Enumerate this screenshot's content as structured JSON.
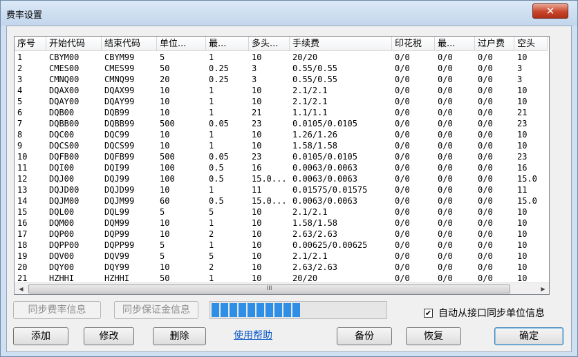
{
  "window": {
    "title": "费率设置",
    "close_glyph": "✕"
  },
  "table": {
    "columns": [
      "序号",
      "开始代码",
      "结束代码",
      "单位...",
      "最...",
      "多头...",
      "手续费",
      "印花税",
      "最...",
      "过户费",
      "空头"
    ],
    "rows": [
      [
        "1",
        "CBYM00",
        "CBYM99",
        "5",
        "1",
        "10",
        "20/20",
        "0/0",
        "0/0",
        "0/0",
        "10"
      ],
      [
        "2",
        "CMES00",
        "CMES99",
        "50",
        "0.25",
        "3",
        "0.55/0.55",
        "0/0",
        "0/0",
        "0/0",
        "3"
      ],
      [
        "3",
        "CMNQ00",
        "CMNQ99",
        "20",
        "0.25",
        "3",
        "0.55/0.55",
        "0/0",
        "0/0",
        "0/0",
        "3"
      ],
      [
        "4",
        "DQAX00",
        "DQAX99",
        "10",
        "1",
        "10",
        "2.1/2.1",
        "0/0",
        "0/0",
        "0/0",
        "10"
      ],
      [
        "5",
        "DQAY00",
        "DQAY99",
        "10",
        "1",
        "10",
        "2.1/2.1",
        "0/0",
        "0/0",
        "0/0",
        "10"
      ],
      [
        "6",
        "DQB00",
        "DQB99",
        "10",
        "1",
        "21",
        "1.1/1.1",
        "0/0",
        "0/0",
        "0/0",
        "21"
      ],
      [
        "7",
        "DQBB00",
        "DQBB99",
        "500",
        "0.05",
        "23",
        "0.0105/0.0105",
        "0/0",
        "0/0",
        "0/0",
        "23"
      ],
      [
        "8",
        "DQC00",
        "DQC99",
        "10",
        "1",
        "10",
        "1.26/1.26",
        "0/0",
        "0/0",
        "0/0",
        "10"
      ],
      [
        "9",
        "DQCS00",
        "DQCS99",
        "10",
        "1",
        "10",
        "1.58/1.58",
        "0/0",
        "0/0",
        "0/0",
        "10"
      ],
      [
        "10",
        "DQFB00",
        "DQFB99",
        "500",
        "0.05",
        "23",
        "0.0105/0.0105",
        "0/0",
        "0/0",
        "0/0",
        "23"
      ],
      [
        "11",
        "DQI00",
        "DQI99",
        "100",
        "0.5",
        "16",
        "0.0063/0.0063",
        "0/0",
        "0/0",
        "0/0",
        "16"
      ],
      [
        "12",
        "DQJ00",
        "DQJ99",
        "100",
        "0.5",
        "15.0...",
        "0.0063/0.0063",
        "0/0",
        "0/0",
        "0/0",
        "15.0"
      ],
      [
        "13",
        "DQJD00",
        "DQJD99",
        "10",
        "1",
        "11",
        "0.01575/0.01575",
        "0/0",
        "0/0",
        "0/0",
        "11"
      ],
      [
        "14",
        "DQJM00",
        "DQJM99",
        "60",
        "0.5",
        "15.0...",
        "0.0063/0.0063",
        "0/0",
        "0/0",
        "0/0",
        "15.0"
      ],
      [
        "15",
        "DQL00",
        "DQL99",
        "5",
        "5",
        "10",
        "2.1/2.1",
        "0/0",
        "0/0",
        "0/0",
        "10"
      ],
      [
        "16",
        "DQM00",
        "DQM99",
        "10",
        "1",
        "10",
        "1.58/1.58",
        "0/0",
        "0/0",
        "0/0",
        "10"
      ],
      [
        "17",
        "DQP00",
        "DQP99",
        "10",
        "2",
        "10",
        "2.63/2.63",
        "0/0",
        "0/0",
        "0/0",
        "10"
      ],
      [
        "18",
        "DQPP00",
        "DQPP99",
        "5",
        "1",
        "10",
        "0.00625/0.00625",
        "0/0",
        "0/0",
        "0/0",
        "10"
      ],
      [
        "19",
        "DQV00",
        "DQV99",
        "5",
        "5",
        "10",
        "2.1/2.1",
        "0/0",
        "0/0",
        "0/0",
        "10"
      ],
      [
        "20",
        "DQY00",
        "DQY99",
        "10",
        "2",
        "10",
        "2.63/2.63",
        "0/0",
        "0/0",
        "0/0",
        "10"
      ],
      [
        "21",
        "HZHHI",
        "HZHHI",
        "50",
        "1",
        "10",
        "20/20",
        "0/0",
        "0/0",
        "0/0",
        "10"
      ]
    ]
  },
  "scroll": {
    "up": "▲",
    "down": "▼",
    "left": "◀",
    "right": "▶",
    "grip": "III"
  },
  "buttons": {
    "sync_fee": "同步费率信息",
    "sync_margin": "同步保证金信息",
    "add": "添加",
    "edit": "修改",
    "delete": "删除",
    "help": "使用帮助",
    "backup": "备份",
    "restore": "恢复",
    "ok": "确定"
  },
  "progress": {
    "value_fraction": 0.55,
    "blocks": 11
  },
  "checkbox": {
    "label": "自动从接口同步单位信息",
    "checked": true,
    "mark": "✔"
  }
}
